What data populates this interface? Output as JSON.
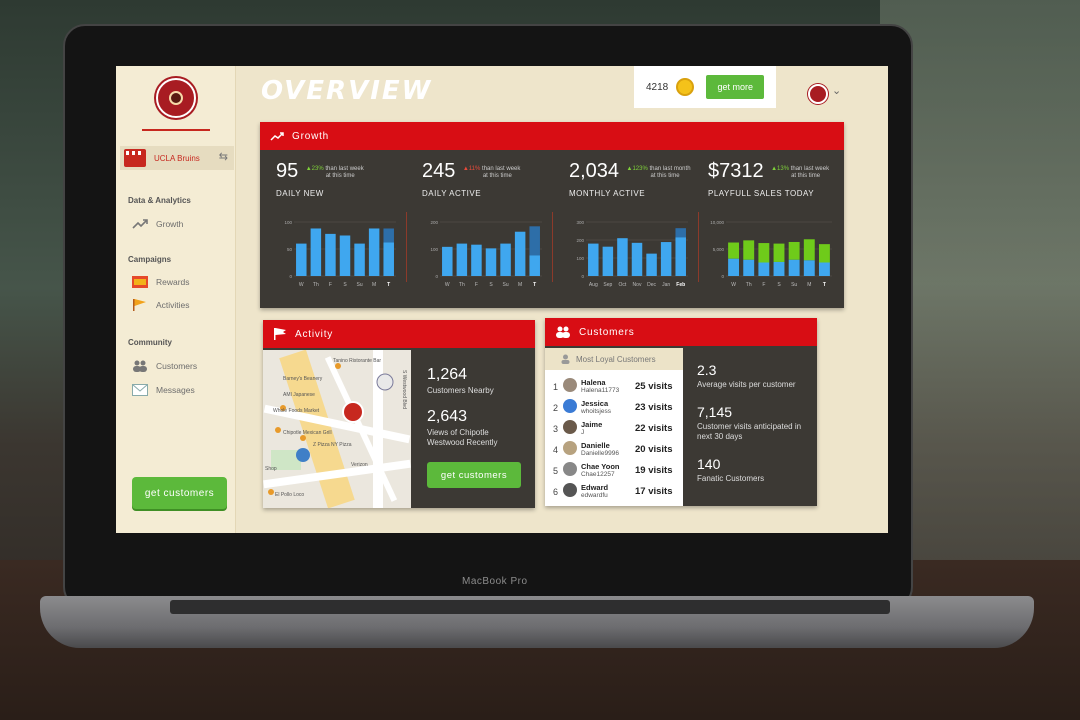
{
  "page": {
    "title": "OVERVIEW"
  },
  "device": {
    "label": "MacBook Pro"
  },
  "colors": {
    "brand_red": "#d80d14",
    "accent_green": "#5cb93b",
    "bar_blue": "#3fa7ef",
    "bar_green": "#6fcb1a",
    "panel_dark": "#3c3934"
  },
  "sidebar": {
    "store_name": "UCLA Bruins",
    "sections": [
      {
        "title": "Data & Analytics",
        "items": [
          {
            "label": "Growth",
            "icon": "trend-icon"
          }
        ]
      },
      {
        "title": "Campaigns",
        "items": [
          {
            "label": "Rewards",
            "icon": "rewards-icon"
          },
          {
            "label": "Activities",
            "icon": "flag-icon"
          }
        ]
      },
      {
        "title": "Community",
        "items": [
          {
            "label": "Customers",
            "icon": "people-icon"
          },
          {
            "label": "Messages",
            "icon": "envelope-icon"
          }
        ]
      }
    ],
    "cta_label": "get customers"
  },
  "header": {
    "points": "4218",
    "get_more_label": "get more"
  },
  "growth": {
    "title": "Growth",
    "stats": [
      {
        "value": "95",
        "change": "23%",
        "change_dir": "up",
        "note1": "than last week",
        "note2": "at this time",
        "label": "DAILY NEW"
      },
      {
        "value": "245",
        "change": "11%",
        "change_dir": "down",
        "note1": "than last week",
        "note2": "at this time",
        "label": "DAILY ACTIVE"
      },
      {
        "value": "2,034",
        "change": "123%",
        "change_dir": "up",
        "note1": "than last month",
        "note2": "at this time",
        "label": "MONTHLY ACTIVE"
      },
      {
        "value": "$7312",
        "change": "13%",
        "change_dir": "up",
        "note1": "than last week",
        "note2": "at this time",
        "label": "PLAYFULL SALES TODAY"
      }
    ]
  },
  "chart_data": [
    {
      "type": "bar",
      "categories": [
        "W",
        "Th",
        "F",
        "S",
        "Su",
        "M",
        "T"
      ],
      "values": [
        60,
        88,
        78,
        75,
        60,
        88,
        62
      ],
      "highlight_last": 88,
      "ylim": [
        0,
        100
      ],
      "yticks": [
        "0",
        "50",
        "100"
      ]
    },
    {
      "type": "bar",
      "categories": [
        "W",
        "Th",
        "F",
        "S",
        "Su",
        "M",
        "T"
      ],
      "values": [
        135,
        150,
        145,
        128,
        150,
        205,
        95
      ],
      "highlight_last": 230,
      "ylim": [
        0,
        250
      ],
      "yticks": [
        "0",
        "100",
        "200"
      ]
    },
    {
      "type": "bar",
      "categories": [
        "Aug",
        "Sep",
        "Oct",
        "Nov",
        "Dec",
        "Jan",
        "Feb"
      ],
      "values": [
        210,
        190,
        245,
        215,
        145,
        220,
        250
      ],
      "highlight_last": 310,
      "ylim": [
        0,
        350
      ],
      "yticks": [
        "0",
        "100",
        "200",
        "300"
      ]
    },
    {
      "type": "bar",
      "categories": [
        "W",
        "Th",
        "F",
        "S",
        "Su",
        "M",
        "T"
      ],
      "series": [
        {
          "values": [
            3200,
            3000,
            2500,
            2600,
            3000,
            2900,
            2500
          ]
        },
        {
          "values": [
            6200,
            6600,
            6100,
            6000,
            6300,
            6800,
            5900
          ]
        }
      ],
      "ylim": [
        0,
        10000
      ],
      "yticks": [
        "0",
        "5,000",
        "10,000"
      ]
    }
  ],
  "activity": {
    "title": "Activity",
    "map_labels": [
      "Tanino Ristorante Bar",
      "Barney's Beanery",
      "AMI Japanese",
      "Whole Foods Market",
      "Chipotle Mexican Grill",
      "Z Pizza NY Pizza",
      "Verizon",
      "El Pollo Loco",
      "Shop",
      "S Westwood Blvd"
    ],
    "stats": [
      {
        "value": "1,264",
        "desc": "Customers Nearby"
      },
      {
        "value": "2,643",
        "desc": "Views of Chipotle Westwood Recently"
      }
    ],
    "cta_label": "get customers"
  },
  "customers": {
    "title": "Customers",
    "loyal_title": "Most Loyal Customers",
    "rows": [
      {
        "rank": "1",
        "name": "Halena",
        "handle": "Halena11773",
        "visits": "25 visits"
      },
      {
        "rank": "2",
        "name": "Jessica",
        "handle": "whoitsjess",
        "visits": "23 visits"
      },
      {
        "rank": "3",
        "name": "Jaime",
        "handle": "J",
        "visits": "22 visits"
      },
      {
        "rank": "4",
        "name": "Danielle",
        "handle": "Danielle9996",
        "visits": "20 visits"
      },
      {
        "rank": "5",
        "name": "Chae Yoon",
        "handle": "Chae12257",
        "visits": "19 visits"
      },
      {
        "rank": "6",
        "name": "Edward",
        "handle": "edwardfu",
        "visits": "17 visits"
      }
    ],
    "stats": [
      {
        "value": "2.3",
        "desc": "Average visits per customer"
      },
      {
        "value": "7,145",
        "desc": "Customer visits anticipated in next 30 days"
      },
      {
        "value": "140",
        "desc": "Fanatic Customers"
      }
    ]
  }
}
